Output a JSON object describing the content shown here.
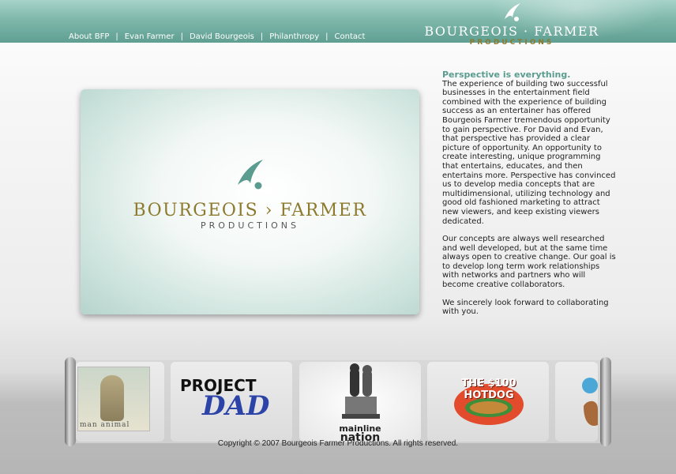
{
  "nav": {
    "items": [
      "About BFP",
      "Evan Farmer",
      "David Bourgeois",
      "Philanthropy",
      "Contact"
    ],
    "separator": "|"
  },
  "brand": {
    "name": "BOURGEOIS · FARMER",
    "sub": "PRODUCTIONS"
  },
  "hero": {
    "name": "BOURGEOIS › FARMER",
    "sub": "PRODUCTIONS"
  },
  "copy": {
    "heading": "Perspective is everything.",
    "paragraphs": [
      "The experience of building two successful businesses in the entertainment field combined with the experience of building success as an entertainer has offered Bourgeois Farmer tremendous opportunity to gain perspective. For David and Evan, that perspective has provided a clear picture of opportunity. An opportunity to create interesting, unique programming that entertains, educates, and then entertains more. Perspective has convinced us to develop media concepts that are multidimensional, utilizing technology and good old fashioned marketing to attract new viewers, and keep existing viewers dedicated.",
      "Our concepts are always well researched and well developed, but at the same time always open to creative change. Our goal is to develop long term work relationships with networks and partners who will become creative collaborators.",
      "We sincerely look forward to collaborating with you."
    ]
  },
  "shows": [
    {
      "label": "man animal"
    },
    {
      "label1": "PROJECT",
      "label2": "DAD"
    },
    {
      "label1": "mainline",
      "label2": "nation"
    },
    {
      "label": "THE $100 HOTDOG"
    },
    {
      "label": ""
    }
  ],
  "footer": {
    "copyright": "Copyright © 2007 Bourgeois Farmer Productions. All rights reserved."
  },
  "colors": {
    "header_teal": "#5f9f92",
    "heading_teal": "#5a9c8f",
    "brand_gold": "#8c7a2e"
  },
  "icons": {
    "brand_mark": "swoosh-dot-logo-icon"
  }
}
